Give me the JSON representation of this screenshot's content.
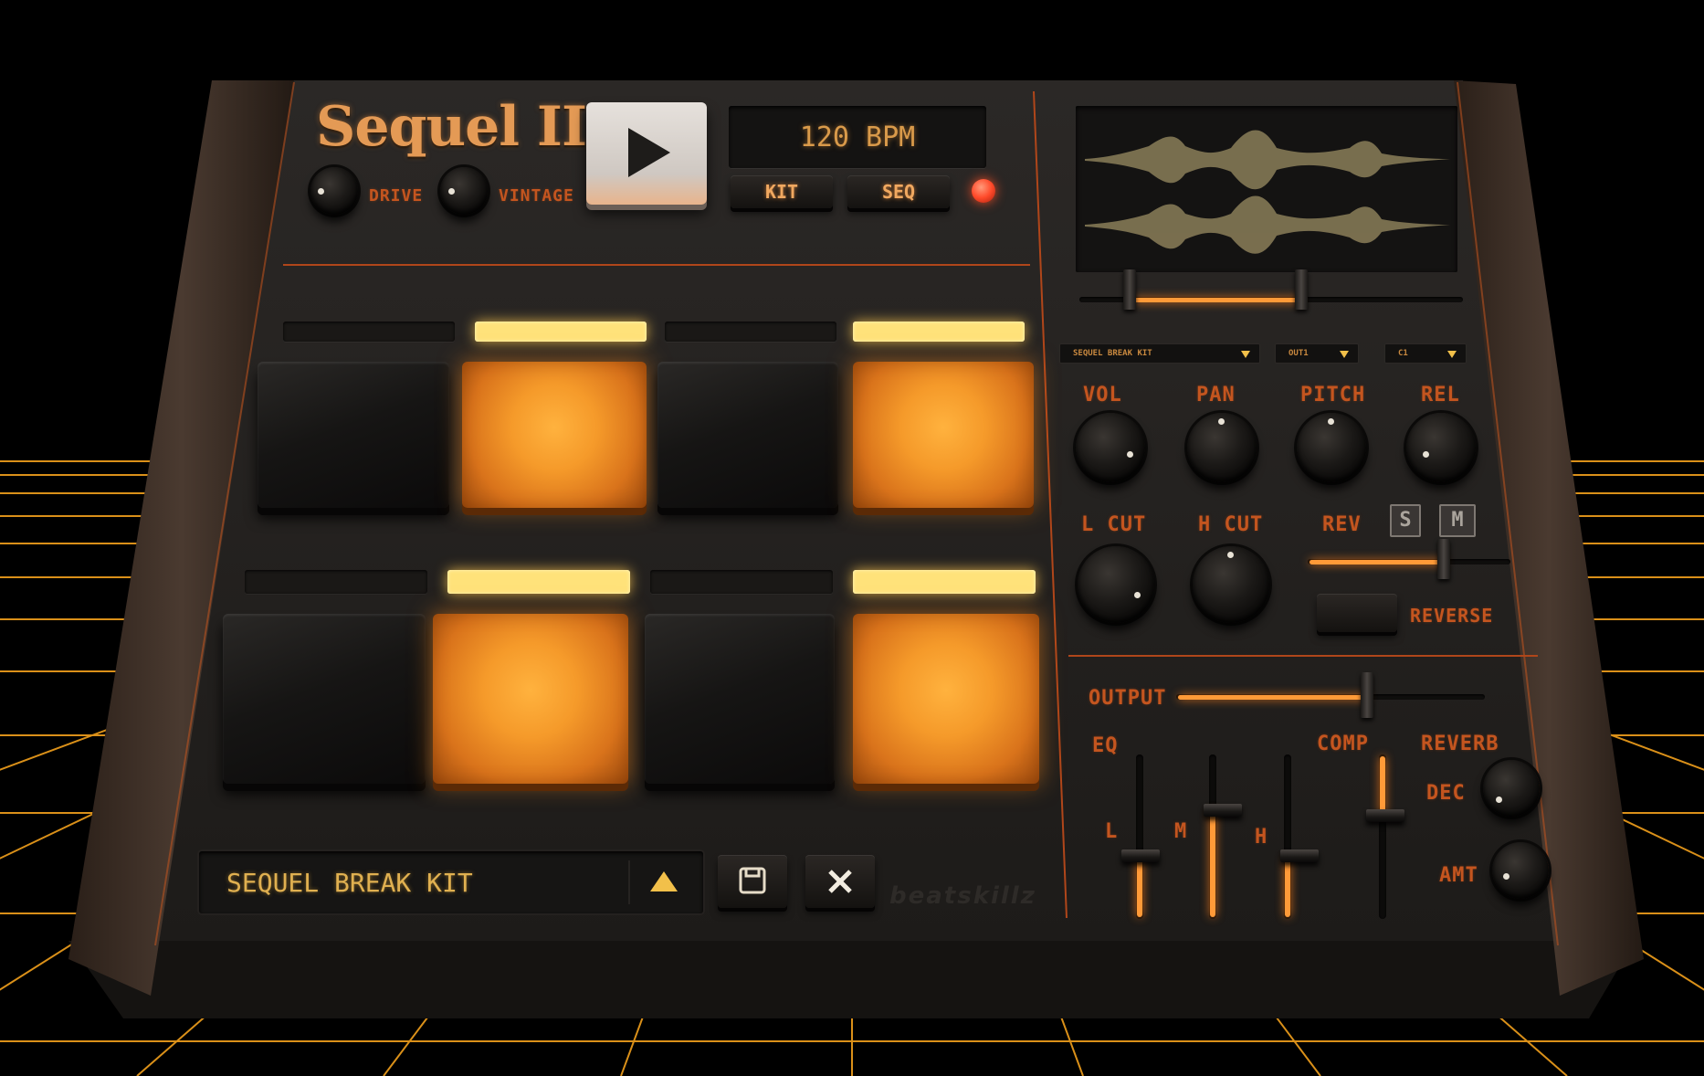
{
  "header": {
    "logo": "Sequel II",
    "bpm_display": "120 BPM",
    "kit_button": "KIT",
    "seq_button": "SEQ",
    "drive_label": "DRIVE",
    "vintage_label": "VINTAGE"
  },
  "pads": {
    "row1": [
      {
        "strip": "off",
        "state": "dark"
      },
      {
        "strip": "on",
        "state": "lit"
      },
      {
        "strip": "off",
        "state": "dark"
      },
      {
        "strip": "on",
        "state": "lit"
      }
    ],
    "row2": [
      {
        "strip": "off",
        "state": "dark"
      },
      {
        "strip": "on",
        "state": "lit"
      },
      {
        "strip": "off",
        "state": "dark"
      },
      {
        "strip": "on",
        "state": "lit"
      }
    ]
  },
  "kit_bar": {
    "kit_name": "SEQUEL BREAK KIT",
    "brand": "beatskillz"
  },
  "sample": {
    "kit_dropdown": "SEQUEL BREAK KIT",
    "output_dropdown": "OUT1",
    "note_dropdown": "C1",
    "range_start": 0.15,
    "range_end": 0.6
  },
  "controls": {
    "vol": "VOL",
    "pan": "PAN",
    "pitch": "PITCH",
    "rel": "REL",
    "lcut": "L CUT",
    "hcut": "H CUT",
    "rev": "REV",
    "solo": "S",
    "mute": "M",
    "reverse": "REVERSE",
    "rev_level": 0.68
  },
  "mixer": {
    "output": "OUTPUT",
    "output_level": 0.72,
    "eq": "EQ",
    "eq_l": "L",
    "eq_m": "M",
    "eq_h": "H",
    "eq_l_level": 0.35,
    "eq_m_level": 0.62,
    "eq_h_level": 0.35,
    "comp": "COMP",
    "comp_level": 0.7,
    "reverb": "REVERB",
    "dec": "DEC",
    "amt": "AMT"
  },
  "colors": {
    "accent": "#c4551f",
    "pad_lit": "#f59a2a",
    "led": "#ff4a2a",
    "grid": "#f2a01c"
  }
}
